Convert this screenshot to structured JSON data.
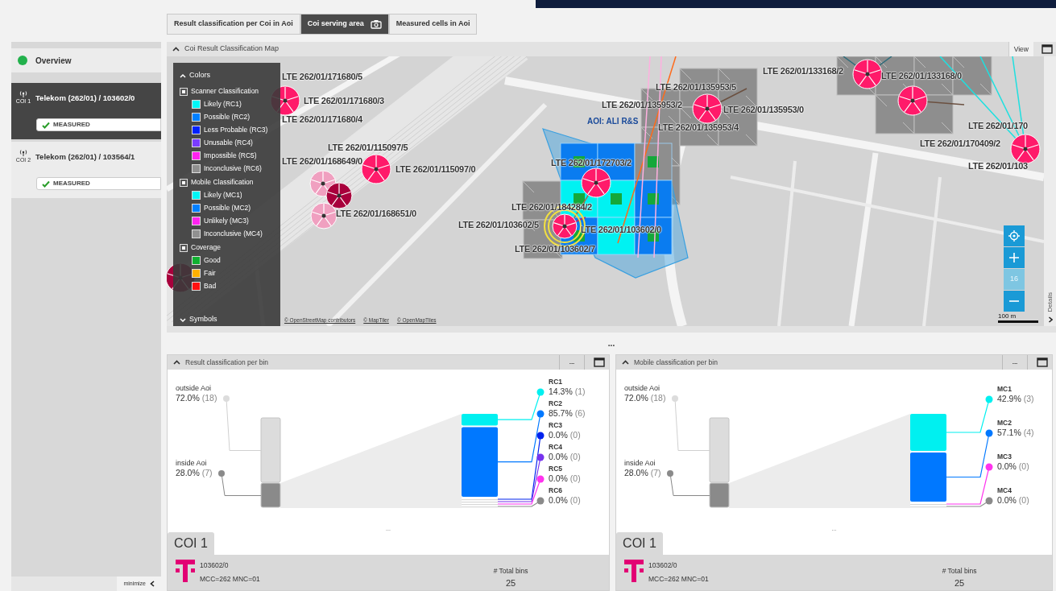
{
  "sidebar": {
    "overview": {
      "label": "Overview"
    },
    "items": [
      {
        "icon_label": "COI 1",
        "title": "Telekom (262/01) / 103602/0",
        "badge": "MEASURED",
        "selected": true
      },
      {
        "icon_label": "COI 2",
        "title": "Telekom (262/01) / 103564/1",
        "badge": "MEASURED",
        "selected": false
      }
    ],
    "minimize": "minimize"
  },
  "tabs": [
    {
      "label": "Result classification per Coi in Aoi",
      "selected": false
    },
    {
      "label": "Coi serving area",
      "selected": true
    },
    {
      "label": "Measured cells in Aoi",
      "selected": false
    }
  ],
  "map_panel": {
    "title": "Coi Result Classification Map",
    "view_button": "View",
    "details_tab": "Details",
    "zoom_level": "16",
    "scale": "100 m",
    "aoi_label": "AOI: ALI R&S",
    "cell_labels": [
      "LTE 262/01/171680/5",
      "LTE 262/01/171680/3",
      "LTE 262/01/171680/4",
      "LTE 262/01/115097/5",
      "LTE 262/01/168649/0",
      "LTE 262/01/115097/0",
      "LTE 262/01/168651/0",
      "LTE 262/01/135953/5",
      "LTE 262/01/135953/2",
      "LTE 262/01/135953/0",
      "LTE 262/01/135953/4",
      "LTE 262/01/133168/2",
      "LTE 262/01/133168/0",
      "LTE 262/01/172703/2",
      "LTE 262/01/184284/2",
      "LTE 262/01/103602/5",
      "LTE 262/01/103602/0",
      "LTE 262/01/103602/7",
      "LTE 262/01/170",
      "LTE 262/01/170409/2",
      "LTE 262/01/103"
    ],
    "attributions": [
      "© OpenStreetMap contributors",
      "© MapTiler",
      "© OpenMapTiles"
    ],
    "legend": {
      "title": "Colors",
      "symbols": "Symbols",
      "sections": [
        {
          "title": "Scanner Classification",
          "items": [
            {
              "label": "Likely (RC1)",
              "color": "#00f6f6"
            },
            {
              "label": "Possible (RC2)",
              "color": "#0080ff"
            },
            {
              "label": "Less Probable (RC3)",
              "color": "#0022ff"
            },
            {
              "label": "Unusable (RC4)",
              "color": "#7a3cff"
            },
            {
              "label": "Impossible (RC5)",
              "color": "#ff22f0"
            },
            {
              "label": "Inconclusive (RC6)",
              "color": "#909090"
            }
          ]
        },
        {
          "title": "Mobile Classification",
          "items": [
            {
              "label": "Likely (MC1)",
              "color": "#00f6f6"
            },
            {
              "label": "Possible (MC2)",
              "color": "#0080ff"
            },
            {
              "label": "Unlikely (MC3)",
              "color": "#ff22f0"
            },
            {
              "label": "Inconclusive (MC4)",
              "color": "#909090"
            }
          ]
        },
        {
          "title": "Coverage",
          "items": [
            {
              "label": "Good",
              "color": "#10b030"
            },
            {
              "label": "Fair",
              "color": "#ffb000"
            },
            {
              "label": "Bad",
              "color": "#ff1010"
            }
          ]
        }
      ]
    }
  },
  "splitter": "...",
  "panels": [
    {
      "title": "Result classification per bin",
      "more": "...",
      "divider": "...",
      "inputs": [
        {
          "label": "outside Aoi",
          "value": "72.0%",
          "count": "(18)",
          "color": "#dcdcdc"
        },
        {
          "label": "inside Aoi",
          "value": "28.0%",
          "count": "(7)",
          "color": "#8a8a8a"
        }
      ],
      "classes": [
        {
          "label": "RC1",
          "value": "14.3%",
          "count": "(1)",
          "color": "#00f0f0"
        },
        {
          "label": "RC2",
          "value": "85.7%",
          "count": "(6)",
          "color": "#0078ff"
        },
        {
          "label": "RC3",
          "value": "0.0%",
          "count": "(0)",
          "color": "#0022ee"
        },
        {
          "label": "RC4",
          "value": "0.0%",
          "count": "(0)",
          "color": "#7733ee"
        },
        {
          "label": "RC5",
          "value": "0.0%",
          "count": "(0)",
          "color": "#ff33ee"
        },
        {
          "label": "RC6",
          "value": "0.0%",
          "count": "(0)",
          "color": "#8a8a8a"
        }
      ],
      "footer": {
        "tab": "COI 1",
        "cell": "103602/0",
        "codes": "MCC=262 MNC=01",
        "total_label": "# Total bins",
        "total": "25"
      }
    },
    {
      "title": "Mobile classification per bin",
      "more": "...",
      "divider": "...",
      "inputs": [
        {
          "label": "outside Aoi",
          "value": "72.0%",
          "count": "(18)",
          "color": "#dcdcdc"
        },
        {
          "label": "inside Aoi",
          "value": "28.0%",
          "count": "(7)",
          "color": "#8a8a8a"
        }
      ],
      "classes": [
        {
          "label": "MC1",
          "value": "42.9%",
          "count": "(3)",
          "color": "#00f0f0"
        },
        {
          "label": "MC2",
          "value": "57.1%",
          "count": "(4)",
          "color": "#0078ff"
        },
        {
          "label": "MC3",
          "value": "0.0%",
          "count": "(0)",
          "color": "#ff33ee"
        },
        {
          "label": "MC4",
          "value": "0.0%",
          "count": "(0)",
          "color": "#8a8a8a"
        }
      ],
      "footer": {
        "tab": "COI 1",
        "cell": "103602/0",
        "codes": "MCC=262 MNC=01",
        "total_label": "# Total bins",
        "total": "25"
      }
    }
  ]
}
